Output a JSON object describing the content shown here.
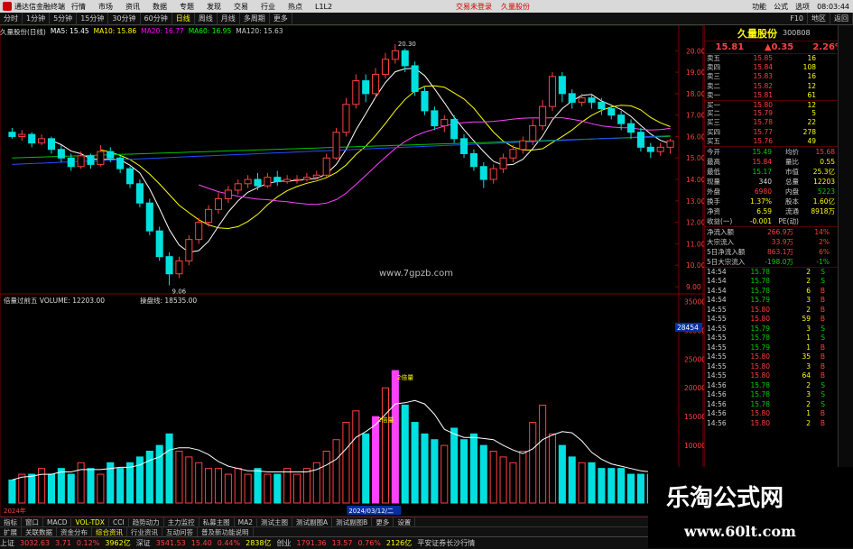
{
  "title_bar": {
    "app": "通达信金融终端",
    "menus": [
      "行情",
      "市场",
      "资讯",
      "数据",
      "专题",
      "发现",
      "交易",
      "行业",
      "热点",
      "L1L2"
    ],
    "center_links": [
      "交易未登录",
      "久量股份"
    ],
    "right_items": [
      "功能",
      "公式",
      "选项",
      "08:03:44"
    ]
  },
  "toolbar": {
    "periods": [
      "分时",
      "1分钟",
      "5分钟",
      "15分钟",
      "30分钟",
      "60分钟",
      "日线",
      "周线",
      "月线",
      "多周期",
      "更多"
    ],
    "active_period": "日线",
    "right": [
      "F10",
      "地区",
      "返回"
    ]
  },
  "ma_line": [
    {
      "label": "久量股份(日线)",
      "color": "#ddd"
    },
    {
      "label": "MA5: 15.45",
      "color": "#fff"
    },
    {
      "label": "MA10: 15.86",
      "color": "#ff0"
    },
    {
      "label": "MA20: 16.77",
      "color": "#f0f"
    },
    {
      "label": "MA60: 16.95",
      "color": "#0f0"
    },
    {
      "label": "MA120: 15.63",
      "color": "#ccc"
    }
  ],
  "price_axis": [
    "20.00",
    "19.00",
    "18.00",
    "17.00",
    "16.00",
    "15.00",
    "14.00",
    "13.00",
    "12.00",
    "11.00",
    "10.00",
    "9.00"
  ],
  "price_annotations": {
    "high": "20.30",
    "low": "9.06",
    "watermark": "www.7gpzb.com"
  },
  "vol_header": {
    "left": "倍量过前五 VOLUME: 12203.00",
    "right": "操盘线: 18535.00"
  },
  "vol_axis": [
    "35000",
    "30000",
    "25000",
    "20000",
    "15000",
    "10000",
    "5000"
  ],
  "vol_side_value": "28454",
  "vol_labels": [
    "2倍量",
    "2倍量"
  ],
  "x_labels": [
    "2024年",
    "2024/03/12/二"
  ],
  "sub_tabs": [
    "指标",
    "窗口",
    "MACD",
    "VOL-TDX",
    "CCI",
    "趋势动力",
    "主力监控",
    "私募主图",
    "MA2",
    "测试主图",
    "测试副图A",
    "测试副图B",
    "更多",
    "设置"
  ],
  "lower_tabs": [
    "扩展",
    "关联数据",
    "资金分布",
    "综合资讯",
    "行业资讯",
    "互动问答",
    "普及新功能说明"
  ],
  "stock": {
    "name": "久量股份",
    "code": "300808",
    "price": "15.81",
    "change": "▲0.35",
    "pct": "2.26%"
  },
  "order_book": [
    {
      "l": "卖五",
      "p": "15.85",
      "v": "16"
    },
    {
      "l": "卖四",
      "p": "15.84",
      "v": "108"
    },
    {
      "l": "卖三",
      "p": "15.83",
      "v": "16"
    },
    {
      "l": "卖二",
      "p": "15.82",
      "v": "12"
    },
    {
      "l": "卖一",
      "p": "15.81",
      "v": "61"
    },
    {
      "l": "买一",
      "p": "15.80",
      "v": "12"
    },
    {
      "l": "买二",
      "p": "15.79",
      "v": "5"
    },
    {
      "l": "买三",
      "p": "15.78",
      "v": "22"
    },
    {
      "l": "买四",
      "p": "15.77",
      "v": "278"
    },
    {
      "l": "买五",
      "p": "15.76",
      "v": "49"
    }
  ],
  "stats": [
    {
      "l1": "今开",
      "v1": "15.49",
      "c1": "grn",
      "l2": "均价",
      "v2": "15.68",
      "c2": "red"
    },
    {
      "l1": "最高",
      "v1": "15.84",
      "c1": "red",
      "l2": "量比",
      "v2": "0.55",
      "c2": "yel"
    },
    {
      "l1": "最低",
      "v1": "15.17",
      "c1": "grn",
      "l2": "市值",
      "v2": "25.3亿",
      "c2": "yel"
    },
    {
      "l1": "现量",
      "v1": "340",
      "c1": "wht",
      "l2": "总量",
      "v2": "12203",
      "c2": "yel"
    },
    {
      "l1": "外盘",
      "v1": "6980",
      "c1": "red",
      "l2": "内盘",
      "v2": "5223",
      "c2": "grn"
    },
    {
      "l1": "换手",
      "v1": "1.37%",
      "c1": "yel",
      "l2": "股本",
      "v2": "1.60亿",
      "c2": "yel"
    },
    {
      "l1": "净资",
      "v1": "6.59",
      "c1": "yel",
      "l2": "流通",
      "v2": "8918万",
      "c2": "yel"
    },
    {
      "l1": "收益(一)",
      "v1": "-0.001",
      "c1": "yel",
      "l2": "PE(动)",
      "v2": "",
      "c2": "yel"
    }
  ],
  "flows": [
    {
      "l": "净流入额",
      "v": "266.9万",
      "p": "14%",
      "c": "red"
    },
    {
      "l": "大宗流入",
      "v": "33.9万",
      "p": "2%",
      "c": "red"
    },
    {
      "l": "5日净流入额",
      "v": "863.1万",
      "p": "6%",
      "c": "red"
    },
    {
      "l": "5日大宗流入",
      "v": "-198.0万",
      "p": "-1%",
      "c": "grn"
    }
  ],
  "ticks": [
    {
      "t": "14:54",
      "p": "15.78",
      "q": "2",
      "s": "S"
    },
    {
      "t": "14:54",
      "p": "15.78",
      "q": "2",
      "s": "S"
    },
    {
      "t": "14:54",
      "p": "15.78",
      "q": "6",
      "s": "B"
    },
    {
      "t": "14:54",
      "p": "15.79",
      "q": "3",
      "s": "B"
    },
    {
      "t": "14:55",
      "p": "15.80",
      "q": "2",
      "s": "B"
    },
    {
      "t": "14:55",
      "p": "15.80",
      "q": "59",
      "s": "B"
    },
    {
      "t": "14:55",
      "p": "15.79",
      "q": "3",
      "s": "S"
    },
    {
      "t": "14:55",
      "p": "15.78",
      "q": "1",
      "s": "S"
    },
    {
      "t": "14:55",
      "p": "15.79",
      "q": "1",
      "s": "B"
    },
    {
      "t": "14:55",
      "p": "15.80",
      "q": "35",
      "s": "B"
    },
    {
      "t": "14:55",
      "p": "15.80",
      "q": "3",
      "s": "B"
    },
    {
      "t": "14:55",
      "p": "15.80",
      "q": "64",
      "s": "B"
    },
    {
      "t": "14:56",
      "p": "15.78",
      "q": "2",
      "s": "S"
    },
    {
      "t": "14:56",
      "p": "15.78",
      "q": "3",
      "s": "S"
    },
    {
      "t": "14:56",
      "p": "15.78",
      "q": "2",
      "s": "S"
    },
    {
      "t": "14:56",
      "p": "15.80",
      "q": "1",
      "s": "B"
    },
    {
      "t": "14:56",
      "p": "15.80",
      "q": "2",
      "s": "B"
    }
  ],
  "status_bar": [
    {
      "l": "上证",
      "v": "3032.63",
      "c": "red"
    },
    {
      "l": "",
      "v": "3.71",
      "c": "red"
    },
    {
      "l": "",
      "v": "0.12%",
      "c": "red"
    },
    {
      "l": "",
      "v": "3962亿",
      "c": "yel"
    },
    {
      "l": "深证",
      "v": "3541.53",
      "c": "red"
    },
    {
      "l": "",
      "v": "15.40",
      "c": "red"
    },
    {
      "l": "",
      "v": "0.44%",
      "c": "red"
    },
    {
      "l": "",
      "v": "2838亿",
      "c": "yel"
    },
    {
      "l": "创业",
      "v": "1791.36",
      "c": "red"
    },
    {
      "l": "",
      "v": "13.57",
      "c": "red"
    },
    {
      "l": "",
      "v": "0.76%",
      "c": "red"
    },
    {
      "l": "",
      "v": "2126亿",
      "c": "yel"
    },
    {
      "l": "平安证券长沙行情",
      "v": "",
      "c": "wht"
    }
  ],
  "watermark": {
    "t1": "乐淘公式网",
    "t2": "www.60lt.com"
  },
  "chart_data": {
    "type": "candlestick",
    "candles": [
      [
        16.2,
        16.0,
        16.4,
        15.9
      ],
      [
        16.0,
        16.1,
        16.3,
        15.8
      ],
      [
        16.1,
        15.7,
        16.2,
        15.5
      ],
      [
        15.7,
        15.9,
        16.1,
        15.6
      ],
      [
        15.9,
        15.4,
        16.0,
        15.2
      ],
      [
        15.4,
        15.0,
        15.6,
        14.8
      ],
      [
        15.0,
        14.6,
        15.2,
        14.4
      ],
      [
        14.6,
        15.1,
        15.3,
        14.5
      ],
      [
        15.1,
        14.7,
        15.2,
        14.5
      ],
      [
        14.7,
        15.3,
        15.6,
        14.6
      ],
      [
        15.3,
        15.0,
        15.5,
        14.8
      ],
      [
        15.0,
        14.5,
        15.1,
        14.3
      ],
      [
        14.5,
        13.8,
        14.6,
        13.6
      ],
      [
        13.8,
        12.9,
        14.0,
        12.7
      ],
      [
        12.9,
        11.6,
        13.1,
        11.4
      ],
      [
        11.6,
        10.4,
        11.8,
        10.2
      ],
      [
        10.4,
        9.6,
        10.6,
        9.06
      ],
      [
        9.6,
        10.2,
        10.4,
        9.4
      ],
      [
        10.2,
        11.2,
        11.4,
        10.0
      ],
      [
        11.2,
        12.0,
        12.2,
        11.0
      ],
      [
        12.0,
        12.6,
        12.8,
        11.8
      ],
      [
        12.6,
        13.1,
        13.4,
        12.4
      ],
      [
        13.1,
        13.5,
        13.7,
        12.9
      ],
      [
        13.5,
        13.8,
        14.0,
        13.3
      ],
      [
        13.8,
        14.0,
        14.2,
        13.6
      ],
      [
        14.0,
        13.7,
        14.3,
        13.5
      ],
      [
        13.7,
        14.1,
        14.3,
        13.6
      ],
      [
        14.1,
        13.9,
        14.4,
        13.7
      ],
      [
        13.9,
        14.0,
        14.2,
        13.8
      ],
      [
        14.0,
        14.0,
        14.2,
        13.8
      ],
      [
        14.0,
        14.1,
        14.3,
        13.9
      ],
      [
        14.1,
        14.2,
        14.4,
        14.0
      ],
      [
        14.2,
        15.0,
        15.2,
        14.1
      ],
      [
        15.0,
        16.2,
        16.4,
        14.9
      ],
      [
        16.2,
        17.5,
        17.8,
        16.0
      ],
      [
        17.5,
        18.6,
        18.9,
        17.3
      ],
      [
        18.6,
        18.0,
        18.9,
        17.6
      ],
      [
        18.0,
        18.9,
        19.2,
        17.8
      ],
      [
        18.9,
        19.6,
        19.9,
        18.7
      ],
      [
        19.6,
        20.0,
        20.3,
        19.4
      ],
      [
        20.0,
        19.3,
        20.1,
        19.0
      ],
      [
        19.3,
        18.1,
        19.5,
        17.9
      ],
      [
        18.1,
        17.2,
        18.3,
        17.0
      ],
      [
        17.2,
        16.5,
        17.4,
        16.3
      ],
      [
        16.5,
        16.8,
        17.0,
        16.2
      ],
      [
        16.8,
        15.9,
        17.0,
        15.7
      ],
      [
        15.9,
        15.2,
        16.1,
        15.0
      ],
      [
        15.2,
        14.6,
        15.4,
        14.4
      ],
      [
        14.6,
        14.0,
        14.8,
        13.6
      ],
      [
        14.0,
        14.5,
        14.7,
        13.8
      ],
      [
        14.5,
        15.0,
        15.2,
        14.3
      ],
      [
        15.0,
        15.4,
        15.6,
        14.8
      ],
      [
        15.4,
        15.8,
        16.0,
        15.2
      ],
      [
        15.8,
        16.5,
        16.8,
        15.6
      ],
      [
        16.5,
        17.4,
        17.7,
        16.3
      ],
      [
        17.4,
        18.8,
        19.0,
        17.2
      ],
      [
        18.8,
        18.0,
        19.0,
        17.6
      ],
      [
        18.0,
        17.6,
        18.2,
        17.3
      ],
      [
        17.6,
        17.8,
        18.0,
        17.4
      ],
      [
        17.8,
        17.6,
        18.0,
        17.3
      ],
      [
        17.6,
        17.3,
        17.8,
        17.0
      ],
      [
        17.3,
        17.0,
        17.5,
        16.8
      ],
      [
        17.0,
        16.6,
        17.2,
        16.3
      ],
      [
        16.6,
        16.2,
        16.8,
        15.9
      ],
      [
        16.2,
        15.5,
        16.4,
        15.3
      ],
      [
        15.5,
        15.3,
        15.7,
        15.0
      ],
      [
        15.3,
        15.5,
        15.7,
        15.1
      ],
      [
        15.5,
        15.8,
        15.9,
        15.2
      ]
    ],
    "volume": [
      4,
      5,
      5,
      6,
      5,
      6,
      5,
      7,
      6,
      5,
      7,
      6,
      7,
      8,
      9,
      10,
      12,
      9,
      8,
      7,
      6,
      6,
      5,
      6,
      5,
      6,
      5,
      5,
      6,
      5,
      6,
      7,
      9,
      11,
      14,
      16,
      12,
      15,
      20,
      23,
      17,
      14,
      12,
      11,
      10,
      13,
      11,
      12,
      10,
      9,
      8,
      7,
      9,
      14,
      17,
      12,
      10,
      8,
      7,
      7,
      6,
      6,
      6,
      5,
      5,
      5,
      4,
      5
    ],
    "vol_unit": "thousand",
    "ylim": [
      9,
      20.6
    ]
  }
}
